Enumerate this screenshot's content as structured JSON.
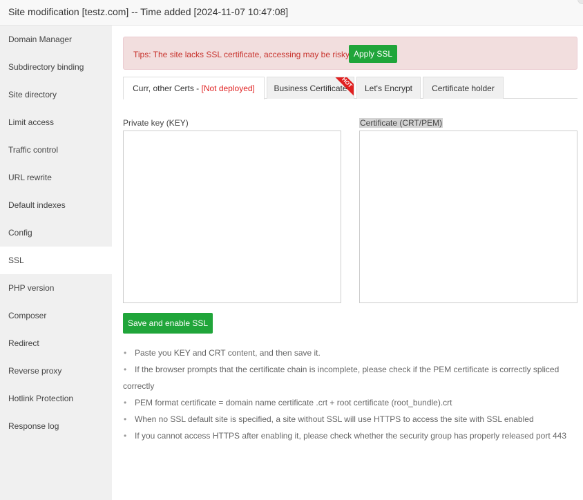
{
  "window": {
    "title": "Site modification [testz.com] -- Time added [2024-11-07 10:47:08]"
  },
  "sidebar": {
    "items": [
      {
        "label": "Domain Manager"
      },
      {
        "label": "Subdirectory binding"
      },
      {
        "label": "Site directory"
      },
      {
        "label": "Limit access"
      },
      {
        "label": "Traffic control"
      },
      {
        "label": "URL rewrite"
      },
      {
        "label": "Default indexes"
      },
      {
        "label": "Config"
      },
      {
        "label": "SSL",
        "active": true
      },
      {
        "label": "PHP version"
      },
      {
        "label": "Composer"
      },
      {
        "label": "Redirect"
      },
      {
        "label": "Reverse proxy"
      },
      {
        "label": "Hotlink Protection"
      },
      {
        "label": "Response log"
      }
    ]
  },
  "tips": {
    "text": "Tips: The site lacks SSL certificate, accessing may be risky.",
    "apply_label": "Apply SSL"
  },
  "tabs": {
    "current": {
      "label": "Curr, other Certs - ",
      "status": "[Not deployed]"
    },
    "business": {
      "label": "Business Certificate",
      "badge": "HOT"
    },
    "letsencrypt": {
      "label": "Let's Encrypt"
    },
    "holder": {
      "label": "Certificate holder"
    }
  },
  "form": {
    "key_label": "Private key (KEY)",
    "cert_label": "Certificate (CRT/PEM)",
    "key_value": "",
    "cert_value": "",
    "save_label": "Save and enable SSL"
  },
  "notes": [
    "Paste you KEY and CRT content, and then save it.",
    "If the browser prompts that the certificate chain is incomplete, please check if the PEM certificate is correctly spliced correctly",
    "PEM format certificate = domain name certificate .crt + root certificate (root_bundle).crt",
    "When no SSL default site is specified, a site without SSL will use HTTPS to access the site with SSL enabled",
    "If you cannot access HTTPS after enabling it, please check whether the security group has properly released port 443"
  ],
  "colors": {
    "accent_green": "#20a53a",
    "warning_red": "#e02020",
    "tips_background": "#f2dede"
  }
}
